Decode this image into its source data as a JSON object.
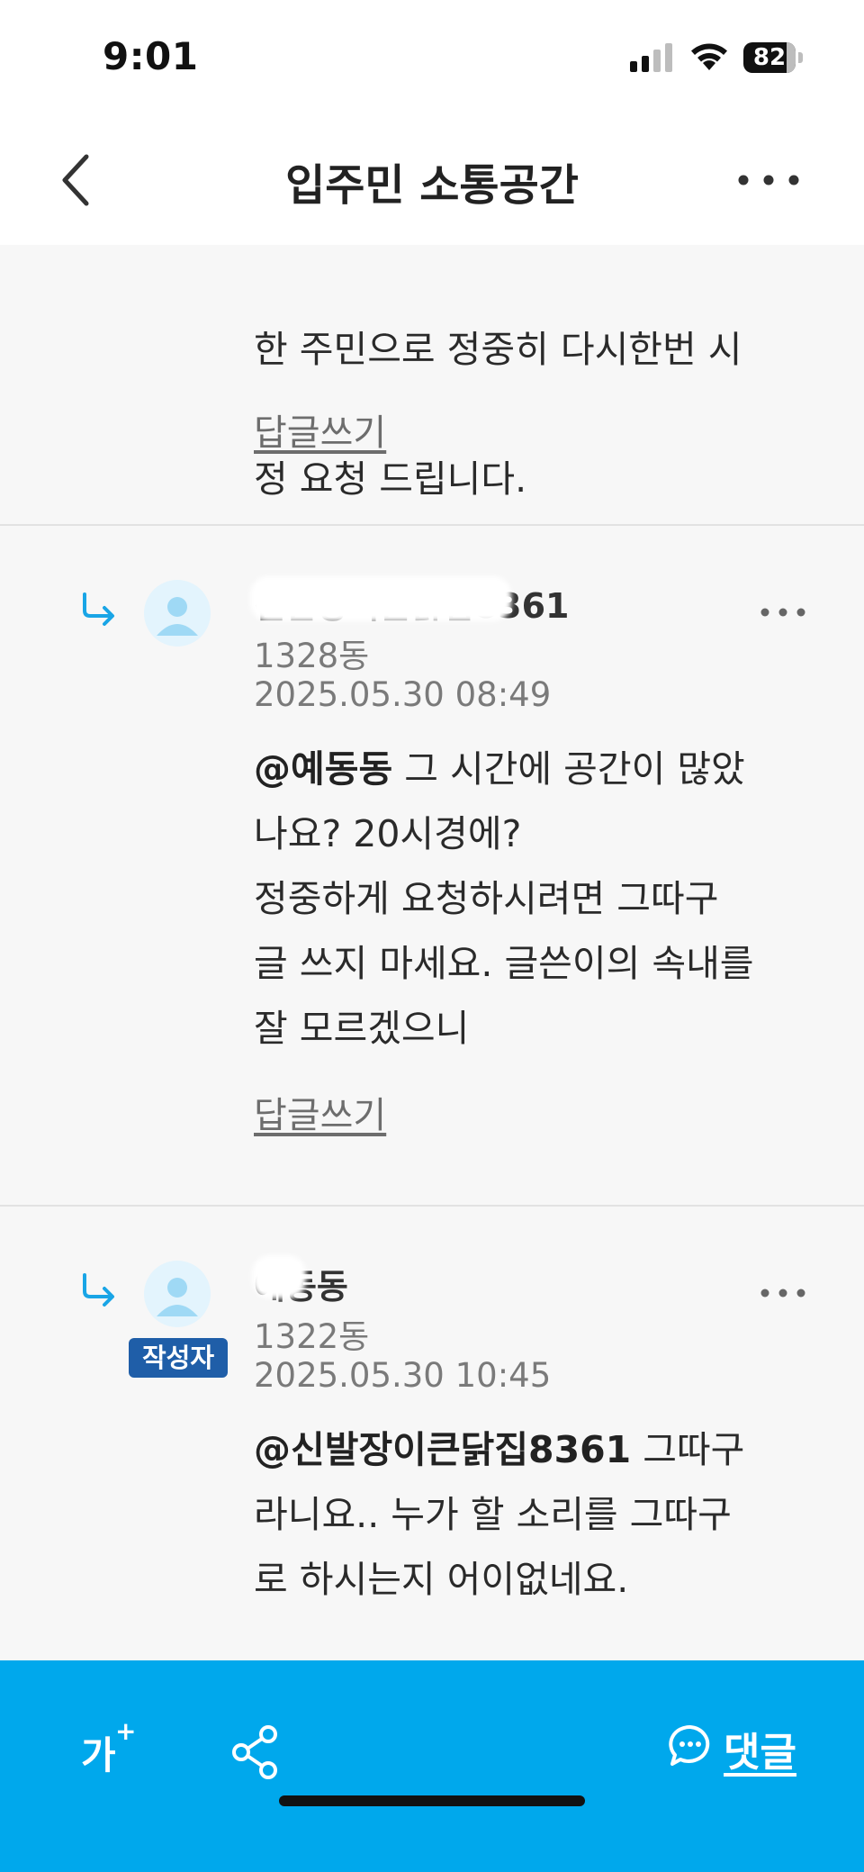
{
  "status_bar": {
    "time": "9:01",
    "battery": "82",
    "battery_level": 0.82
  },
  "header": {
    "title": "입주민 소통공간",
    "back_icon": "chevron-left-icon",
    "more_icon": "more-horizontal-icon"
  },
  "comments": [
    {
      "text_lines": [
        "한 주민으로 정중히 다시한번 시",
        "정 요청 드립니다."
      ],
      "reply_label": "답글쓰기"
    },
    {
      "author": "신발장이큰닭집8361",
      "dong": "1328동",
      "date": "2025.05.30 08:49",
      "mention": "@예동동",
      "text_after_mention": " 그 시간에 공간이 많았",
      "text_rest": "나요? 20시경에?\n정중하게 요청하시려면 그따구\n글 쓰지 마세요. 글쓴이의 속내를\n잘 모르겠으니",
      "reply_label": "답글쓰기"
    },
    {
      "author": "예동동",
      "badge": "작성자",
      "dong": "1322동",
      "date": "2025.05.30 10:45",
      "mention": "@신발장이큰닭집8361",
      "text_after_mention": " 그따구",
      "text_rest": "라니요.. 누가 할 소리를 그따구\n로 하시는지 어이없네요."
    }
  ],
  "bottom_bar": {
    "font_size_label": "가",
    "font_size_plus": "+",
    "share_icon": "share-icon",
    "comment_icon": "comment-bubble-icon",
    "comment_label": "댓글"
  },
  "colors": {
    "accent": "#00a8ec",
    "badge": "#1f5ea8",
    "avatar_bg": "#e3f4fd",
    "avatar_fg": "#9fd9f5"
  }
}
